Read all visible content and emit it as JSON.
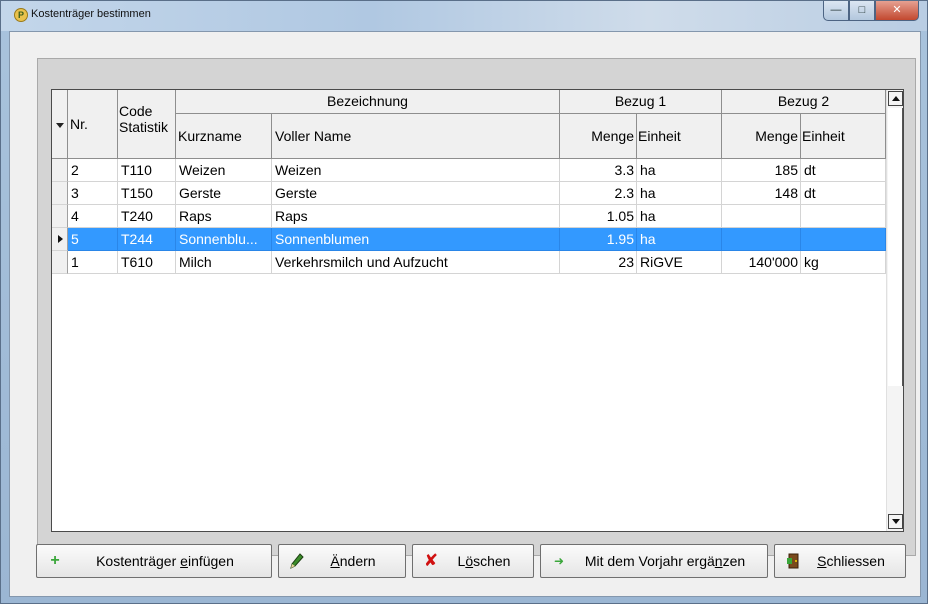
{
  "window": {
    "title": "Kostenträger bestimmen"
  },
  "grid": {
    "group_headers": {
      "bezeichnung": "Bezeichnung",
      "bezug1": "Bezug 1",
      "bezug2": "Bezug 2"
    },
    "columns": {
      "nr": "Nr.",
      "code": "Code\nStatistik",
      "kurzname": "Kurzname",
      "voller_name": "Voller Name",
      "b1_menge": "Menge",
      "b1_einheit": "Einheit",
      "b2_menge": "Menge",
      "b2_einheit": "Einheit"
    },
    "rows": [
      {
        "nr": "2",
        "code": "T110",
        "kurzname": "Weizen",
        "voller_name": "Weizen",
        "b1_menge": "3.3",
        "b1_einheit": "ha",
        "b2_menge": "185",
        "b2_einheit": "dt",
        "selected": false
      },
      {
        "nr": "3",
        "code": "T150",
        "kurzname": "Gerste",
        "voller_name": "Gerste",
        "b1_menge": "2.3",
        "b1_einheit": "ha",
        "b2_menge": "148",
        "b2_einheit": "dt",
        "selected": false
      },
      {
        "nr": "4",
        "code": "T240",
        "kurzname": "Raps",
        "voller_name": "Raps",
        "b1_menge": "1.05",
        "b1_einheit": "ha",
        "b2_menge": "",
        "b2_einheit": "",
        "selected": false
      },
      {
        "nr": "5",
        "code": "T244",
        "kurzname": "Sonnenblu...",
        "voller_name": "Sonnenblumen",
        "b1_menge": "1.95",
        "b1_einheit": "ha",
        "b2_menge": "",
        "b2_einheit": "",
        "selected": true
      },
      {
        "nr": "1",
        "code": "T610",
        "kurzname": "Milch",
        "voller_name": "Verkehrsmilch und Aufzucht",
        "b1_menge": "23",
        "b1_einheit": "RiGVE",
        "b2_menge": "140'000",
        "b2_einheit": "kg",
        "selected": false
      }
    ]
  },
  "buttons": {
    "add": {
      "pre": "Kostenträger ",
      "acc": "e",
      "post": "infügen",
      "icon": "plus-icon"
    },
    "edit": {
      "pre": "",
      "acc": "Ä",
      "post": "ndern",
      "icon": "pencil-icon"
    },
    "delete": {
      "pre": "L",
      "acc": "ö",
      "post": "schen",
      "icon": "red-x-icon"
    },
    "complete": {
      "pre": "Mit dem Vorjahr ergä",
      "acc": "n",
      "post": "zen",
      "icon": "arrow-import-icon"
    },
    "close": {
      "pre": "",
      "acc": "S",
      "post": "chliessen",
      "icon": "exit-door-icon"
    }
  },
  "colors": {
    "selection": "#3399ff",
    "plus": "#3aa63a",
    "delete_x": "#d01010"
  }
}
